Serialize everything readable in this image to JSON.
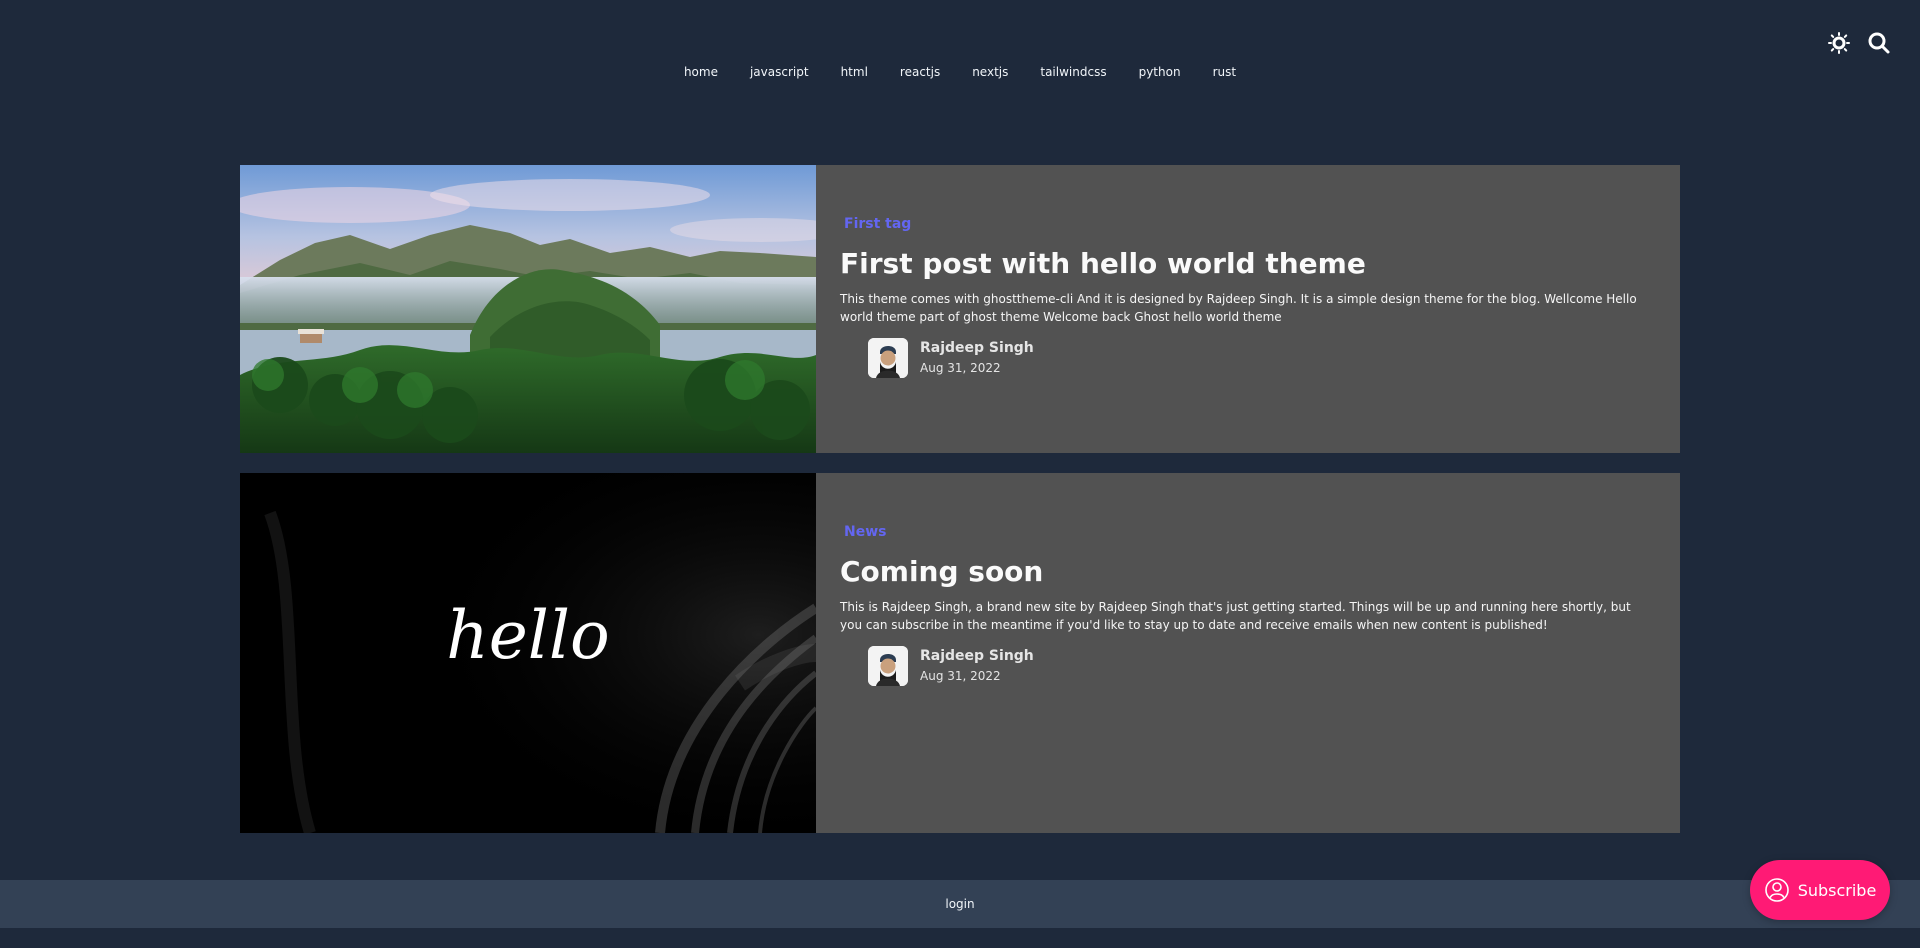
{
  "colors": {
    "page_bg": "#1e293b",
    "card_bg": "#525252",
    "tag": "#6366f1",
    "footer_bg": "#334155",
    "subscribe_bg": "#ff1a75"
  },
  "nav": {
    "items": [
      {
        "label": "home"
      },
      {
        "label": "javascript"
      },
      {
        "label": "html"
      },
      {
        "label": "reactjs"
      },
      {
        "label": "nextjs"
      },
      {
        "label": "tailwindcss"
      },
      {
        "label": "python"
      },
      {
        "label": "rust"
      }
    ],
    "icons": [
      "theme-toggle-icon",
      "search-icon"
    ]
  },
  "posts": [
    {
      "tag": "First tag",
      "title": "First post with hello world theme",
      "excerpt": "This theme comes with ghosttheme-cli And it is designed by Rajdeep Singh. It is a simple design theme for the blog. Wellcome Hello world theme part of ghost theme Welcome back Ghost hello world theme",
      "author": "Rajdeep Singh",
      "date": "Aug 31, 2022"
    },
    {
      "tag": "News",
      "title": "Coming soon",
      "excerpt": "This is Rajdeep Singh, a brand new site by Rajdeep Singh that's just getting started. Things will be up and running here shortly, but you can subscribe in the meantime if you'd like to stay up to date and receive emails when new content is published!",
      "author": "Rajdeep Singh",
      "date": "Aug 31, 2022",
      "image_text": "hello"
    }
  ],
  "footer": {
    "login_label": "login"
  },
  "subscribe": {
    "label": "Subscribe",
    "icon": "user-circle-icon"
  }
}
